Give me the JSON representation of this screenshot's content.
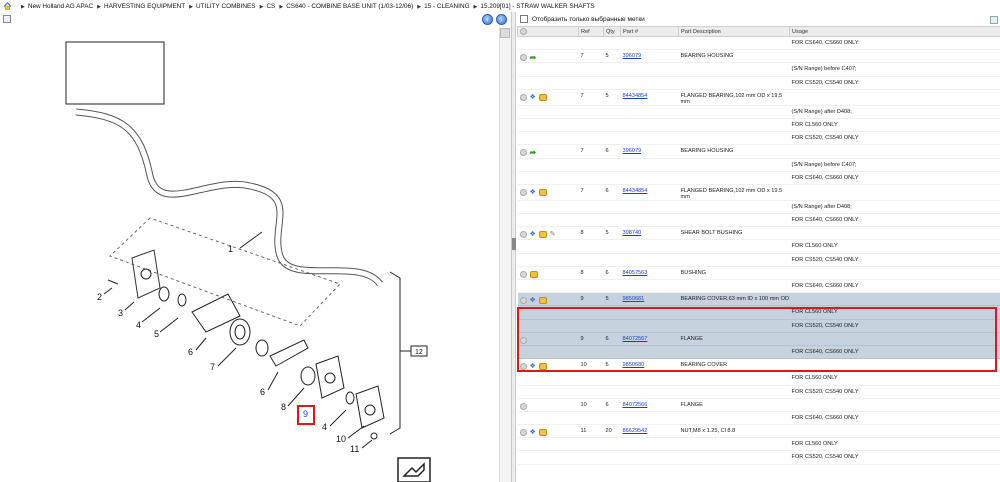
{
  "breadcrumb": [
    "New Holland AG APAC",
    "HARVESTING EQUIPMENT",
    "UTILITY COMBINES",
    "CS",
    "CS640 - COMBINE BASE UNIT (1/03-12/06)",
    "15 - CLEANING",
    "15.209[01] - STRAW WALKER SHAFTS"
  ],
  "filter": {
    "label": "Отобразить только выбранные метки"
  },
  "table": {
    "headers": [
      "",
      "Ref",
      "Qty",
      "Part #",
      "Part Description",
      "Usage"
    ],
    "rows": [
      {
        "icons": [],
        "ref": "",
        "qty": "",
        "part": "",
        "desc": "",
        "usage": "FOR CS640, CS660 ONLY",
        "sel": false
      },
      {
        "icons": [
          "circle",
          "arrow"
        ],
        "ref": "7",
        "qty": "5",
        "part": "396079",
        "desc": "BEARING HOUSING",
        "usage": "",
        "sel": false
      },
      {
        "icons": [],
        "ref": "",
        "qty": "",
        "part": "",
        "desc": "",
        "usage": "(S/N Range) before C407;",
        "sel": false
      },
      {
        "icons": [],
        "ref": "",
        "qty": "",
        "part": "",
        "desc": "",
        "usage": "FOR CS520, CS540 ONLY",
        "sel": false
      },
      {
        "icons": [
          "circle",
          "blue",
          "gold"
        ],
        "ref": "7",
        "qty": "5",
        "part": "84434854",
        "desc": "FLANGED BEARING,102 mm OD x 19.5 mm",
        "usage": "",
        "sel": false
      },
      {
        "icons": [],
        "ref": "",
        "qty": "",
        "part": "",
        "desc": "",
        "usage": "(S/N Range) after D408;",
        "sel": false
      },
      {
        "icons": [],
        "ref": "",
        "qty": "",
        "part": "",
        "desc": "",
        "usage": "FOR CL560 ONLY",
        "sel": false
      },
      {
        "icons": [],
        "ref": "",
        "qty": "",
        "part": "",
        "desc": "",
        "usage": "FOR CS520, CS540 ONLY",
        "sel": false
      },
      {
        "icons": [
          "circle",
          "arrow"
        ],
        "ref": "7",
        "qty": "6",
        "part": "396079",
        "desc": "BEARING HOUSING",
        "usage": "",
        "sel": false
      },
      {
        "icons": [],
        "ref": "",
        "qty": "",
        "part": "",
        "desc": "",
        "usage": "(S/N Range) before C407;",
        "sel": false
      },
      {
        "icons": [],
        "ref": "",
        "qty": "",
        "part": "",
        "desc": "",
        "usage": "FOR CS640, CS660 ONLY",
        "sel": false
      },
      {
        "icons": [
          "circle",
          "blue",
          "gold"
        ],
        "ref": "7",
        "qty": "6",
        "part": "84434854",
        "desc": "FLANGED BEARING,102 mm OD x 19.5 mm",
        "usage": "",
        "sel": false
      },
      {
        "icons": [],
        "ref": "",
        "qty": "",
        "part": "",
        "desc": "",
        "usage": "(S/N Range) after D408;",
        "sel": false
      },
      {
        "icons": [],
        "ref": "",
        "qty": "",
        "part": "",
        "desc": "",
        "usage": "FOR CS640, CS660 ONLY",
        "sel": false
      },
      {
        "icons": [
          "circle",
          "blue",
          "gold",
          "wrench"
        ],
        "ref": "8",
        "qty": "5",
        "part": "398740",
        "desc": "SHEAR BOLT BUSHING",
        "usage": "",
        "sel": false
      },
      {
        "icons": [],
        "ref": "",
        "qty": "",
        "part": "",
        "desc": "",
        "usage": "FOR CL560 ONLY",
        "sel": false
      },
      {
        "icons": [],
        "ref": "",
        "qty": "",
        "part": "",
        "desc": "",
        "usage": "FOR CS520, CS540 ONLY",
        "sel": false
      },
      {
        "icons": [
          "circle",
          "gold"
        ],
        "ref": "8",
        "qty": "6",
        "part": "84057563",
        "desc": "BUSHING",
        "usage": "",
        "sel": false
      },
      {
        "icons": [],
        "ref": "",
        "qty": "",
        "part": "",
        "desc": "",
        "usage": "FOR CS640, CS660 ONLY",
        "sel": false
      },
      {
        "icons": [
          "circle",
          "blue",
          "gold"
        ],
        "ref": "9",
        "qty": "5",
        "part": "9850681",
        "desc": "BEARING COVER,63 mm ID x 100 mm OD",
        "usage": "",
        "sel": true
      },
      {
        "icons": [],
        "ref": "",
        "qty": "",
        "part": "",
        "desc": "",
        "usage": "FOR CL560 ONLY",
        "sel": true
      },
      {
        "icons": [],
        "ref": "",
        "qty": "",
        "part": "",
        "desc": "",
        "usage": "FOR CS520, CS540 ONLY",
        "sel": true
      },
      {
        "icons": [
          "circle"
        ],
        "ref": "9",
        "qty": "6",
        "part": "84072567",
        "desc": "FLANGE",
        "usage": "",
        "sel": true
      },
      {
        "icons": [],
        "ref": "",
        "qty": "",
        "part": "",
        "desc": "",
        "usage": "FOR CS640, CS660 ONLY",
        "sel": true
      },
      {
        "icons": [
          "circle",
          "blue",
          "gold"
        ],
        "ref": "10",
        "qty": "5",
        "part": "9850680",
        "desc": "BEARING COVER",
        "usage": "",
        "sel": false
      },
      {
        "icons": [],
        "ref": "",
        "qty": "",
        "part": "",
        "desc": "",
        "usage": "FOR CL560 ONLY",
        "sel": false
      },
      {
        "icons": [],
        "ref": "",
        "qty": "",
        "part": "",
        "desc": "",
        "usage": "FOR CS520, CS540 ONLY",
        "sel": false
      },
      {
        "icons": [
          "circle"
        ],
        "ref": "10",
        "qty": "6",
        "part": "84072566",
        "desc": "FLANGE",
        "usage": "",
        "sel": false
      },
      {
        "icons": [],
        "ref": "",
        "qty": "",
        "part": "",
        "desc": "",
        "usage": "FOR CS640, CS660 ONLY",
        "sel": false
      },
      {
        "icons": [
          "circle",
          "blue",
          "gold"
        ],
        "ref": "11",
        "qty": "20",
        "part": "86629542",
        "desc": "NUT,M8 x 1.25, Cl 8.8",
        "usage": "",
        "sel": false
      },
      {
        "icons": [],
        "ref": "",
        "qty": "",
        "part": "",
        "desc": "",
        "usage": "FOR CL560 ONLY",
        "sel": false
      },
      {
        "icons": [],
        "ref": "",
        "qty": "",
        "part": "",
        "desc": "",
        "usage": "FOR CS520, CS540 ONLY",
        "sel": false
      }
    ]
  },
  "diagram": {
    "callouts": [
      "1",
      "2",
      "3",
      "4",
      "5",
      "6",
      "7",
      "6",
      "8",
      "9",
      "4",
      "10",
      "11",
      "12"
    ],
    "selected_callout": "9"
  },
  "colors": {
    "link": "#1a3fcc",
    "selected_row": "#c6d2de",
    "highlight_border": "#d9191a"
  },
  "icons": [
    "home-icon",
    "fit-icon",
    "prev-icon",
    "next-icon",
    "next-page-icon"
  ]
}
